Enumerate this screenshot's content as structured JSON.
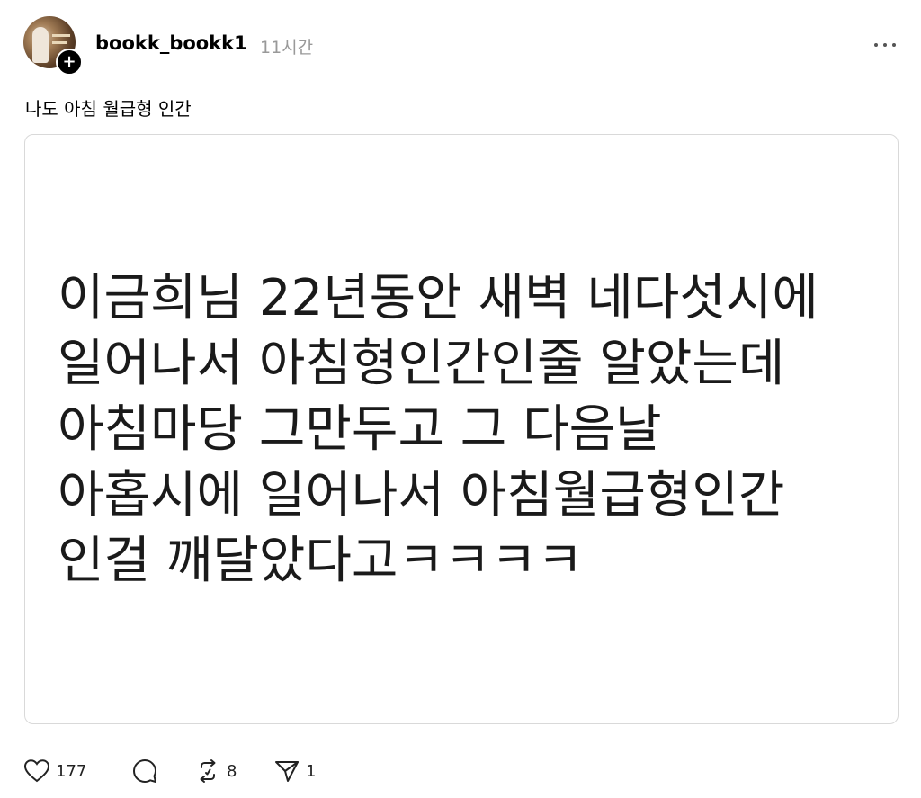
{
  "post": {
    "username": "bookk_bookk1",
    "time_ago": "11시간",
    "caption": "나도 아침 월급형 인간",
    "image_text_lines": [
      "이금희님 22년동안 새벽 네다섯시에",
      "일어나서 아침형인간인줄 알았는데",
      "아침마당 그만두고 그 다음날",
      "아홉시에 일어나서 아침월급형인간",
      "인걸 깨달았다고ㅋㅋㅋㅋ"
    ],
    "follow_symbol": "+",
    "actions": {
      "like_icon": "heart-icon",
      "like_count": "177",
      "comment_icon": "comment-icon",
      "repost_icon": "repost-icon",
      "repost_count": "8",
      "share_icon": "send-icon",
      "share_count": "1"
    },
    "colors": {
      "text": "#000000",
      "muted": "#999999",
      "border": "#d9d9d9"
    }
  }
}
